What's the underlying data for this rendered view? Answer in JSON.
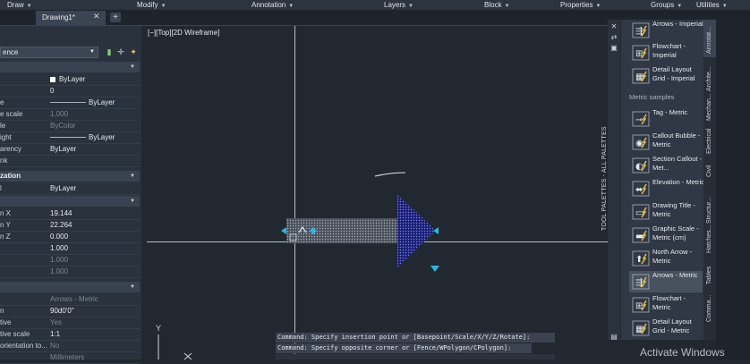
{
  "ribbon": {
    "menus": [
      "Draw",
      "Modify",
      "Annotation",
      "Layers",
      "Block",
      "Properties",
      "Groups",
      "Utilities"
    ]
  },
  "tabs": {
    "active": "Drawing1*",
    "close": "✕",
    "add": "+"
  },
  "properties": {
    "layer_value": "ence",
    "rows_general": [
      {
        "label": "",
        "value": "ByLayer",
        "kind": "color"
      },
      {
        "label": "",
        "value": "0"
      },
      {
        "label": "e",
        "value": "ByLayer",
        "kind": "line"
      },
      {
        "label": "e scale",
        "value": "1.000",
        "dim": true
      },
      {
        "label": "le",
        "value": "ByColor",
        "dim": true
      },
      {
        "label": "ight",
        "value": "ByLayer",
        "kind": "line"
      },
      {
        "label": "arency",
        "value": "ByLayer"
      },
      {
        "label": "nk",
        "value": ""
      }
    ],
    "section_viz": "zation",
    "rows_viz": [
      {
        "label": "l",
        "value": "ByLayer"
      }
    ],
    "rows_geo": [
      {
        "label": "n X",
        "value": "19.144"
      },
      {
        "label": "n Y",
        "value": "22.264"
      },
      {
        "label": "n Z",
        "value": "0.000"
      },
      {
        "label": "",
        "value": "1.000"
      },
      {
        "label": "",
        "value": "1.000",
        "dim": true
      },
      {
        "label": "",
        "value": "1.000",
        "dim": true
      }
    ],
    "rows_misc": [
      {
        "label": "",
        "value": "Arrows - Metric",
        "dim": true
      },
      {
        "label": "n",
        "value": "90d0'0\""
      },
      {
        "label": "tive",
        "value": "Yes",
        "dim": true
      },
      {
        "label": "tive scale",
        "value": "1:1"
      },
      {
        "label": "orientation to...",
        "value": "No",
        "dim": true
      },
      {
        "label": "",
        "value": "Millimeters",
        "dim": true
      }
    ]
  },
  "viewport": {
    "label": "[−][Top][2D Wireframe]"
  },
  "command": {
    "line1": "Command:  Specify insertion point or [Basepoint/Scale/X/Y/Z/Rotate]:",
    "line2": "Command: Specify opposite corner or [Fence/WPolygon/CPolygon]:"
  },
  "palette": {
    "title": "TOOL PALETTES - ALL PALETTES",
    "metric_header": "Metric samples",
    "items_top": [
      {
        "label": "Arrows - Imperial",
        "icon": "arrows-icon"
      },
      {
        "label": "Flowchart - Imperial",
        "icon": "flowchart-icon"
      },
      {
        "label": "Detail Layout Grid - Imperial",
        "icon": "grid-icon"
      }
    ],
    "items_metric": [
      {
        "label": "Tag - Metric",
        "icon": "tag-icon"
      },
      {
        "label": "Callout Bubble - Metric",
        "icon": "callout-icon"
      },
      {
        "label": "Section Callout - Met...",
        "icon": "section-icon"
      },
      {
        "label": "Elevation - Metric",
        "icon": "elevation-icon"
      },
      {
        "label": "Drawing Title - Metric",
        "icon": "title-icon"
      },
      {
        "label": "Graphic Scale - Metric (cm)",
        "icon": "scale-icon"
      },
      {
        "label": "North Arrow - Metric",
        "icon": "north-arrow-icon"
      },
      {
        "label": "Arrows - Metric",
        "icon": "arrows-icon"
      },
      {
        "label": "Flowchart - Metric",
        "icon": "flowchart-icon"
      },
      {
        "label": "Detail Layout Grid - Metric",
        "icon": "grid-icon"
      }
    ],
    "tabs": [
      "Annotat...",
      "Archite...",
      "Mechan...",
      "Electrical",
      "Civil",
      "Structur...",
      "Hatches...",
      "Tables",
      "Comma..."
    ]
  },
  "watermark": "Activate Windows",
  "colors": {
    "arrow_fill": "#1b1f7a",
    "grip": "#29b6e8",
    "canvas": "#212830"
  }
}
